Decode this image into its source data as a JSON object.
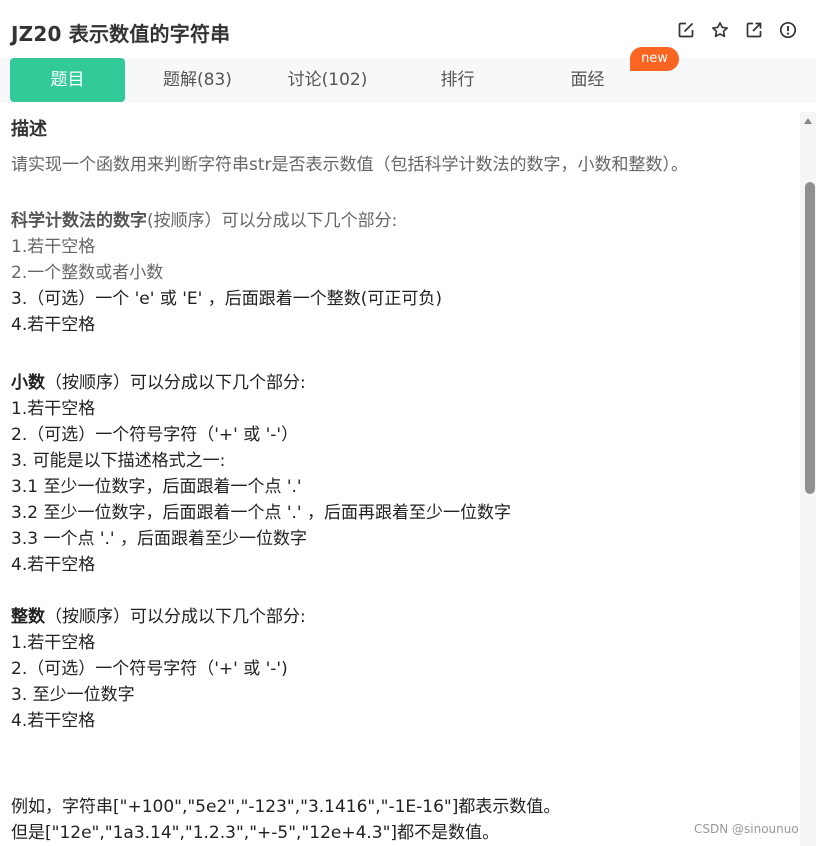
{
  "header": {
    "title": "JZ20  表示数值的字符串",
    "icons": [
      "edit-icon",
      "star-icon",
      "external-link-icon",
      "info-icon"
    ]
  },
  "tabs": [
    {
      "label": "题目",
      "active": true
    },
    {
      "label": "题解(83)",
      "active": false
    },
    {
      "label": "讨论(102)",
      "active": false
    },
    {
      "label": "排行",
      "active": false
    },
    {
      "label": "面经",
      "active": false
    }
  ],
  "badge": {
    "label": "new",
    "color": "#fa6522"
  },
  "colors": {
    "accent": "#32ca99"
  },
  "content": {
    "section_title": "描述",
    "intro": "请实现一个函数用来判断字符串str是否表示数值（包括科学计数法的数字，小数和整数）。",
    "sci": {
      "head_bold": "科学计数法的数字",
      "head_rest": "(按顺序）可以分成以下几个部分:",
      "lines": [
        "1.若干空格",
        "2.一个整数或者小数",
        "3.（可选）一个 'e' 或 'E' ，后面跟着一个整数(可正可负)",
        "4.若干空格"
      ]
    },
    "decimal": {
      "head_bold": "小数",
      "head_rest": "（按顺序）可以分成以下几个部分:",
      "lines": [
        "1.若干空格",
        "2.（可选）一个符号字符（'+' 或 '-'）",
        "3. 可能是以下描述格式之一:",
        "3.1 至少一位数字，后面跟着一个点 '.'",
        "3.2 至少一位数字，后面跟着一个点 '.' ，后面再跟着至少一位数字",
        "3.3 一个点 '.' ，后面跟着至少一位数字",
        "4.若干空格"
      ]
    },
    "integer": {
      "head_bold": "整数",
      "head_rest": "（按顺序）可以分成以下几个部分:",
      "lines": [
        "1.若干空格",
        "2.（可选）一个符号字符（'+' 或 '-')",
        "3. 至少一位数字",
        "4.若干空格"
      ]
    },
    "example_lines": [
      "例如，字符串[\"+100\",\"5e2\",\"-123\",\"3.1416\",\"-1E-16\"]都表示数值。",
      "但是[\"12e\",\"1a3.14\",\"1.2.3\",\"+-5\",\"12e+4.3\"]都不是数值。"
    ]
  },
  "watermark": "CSDN @sinounuo"
}
